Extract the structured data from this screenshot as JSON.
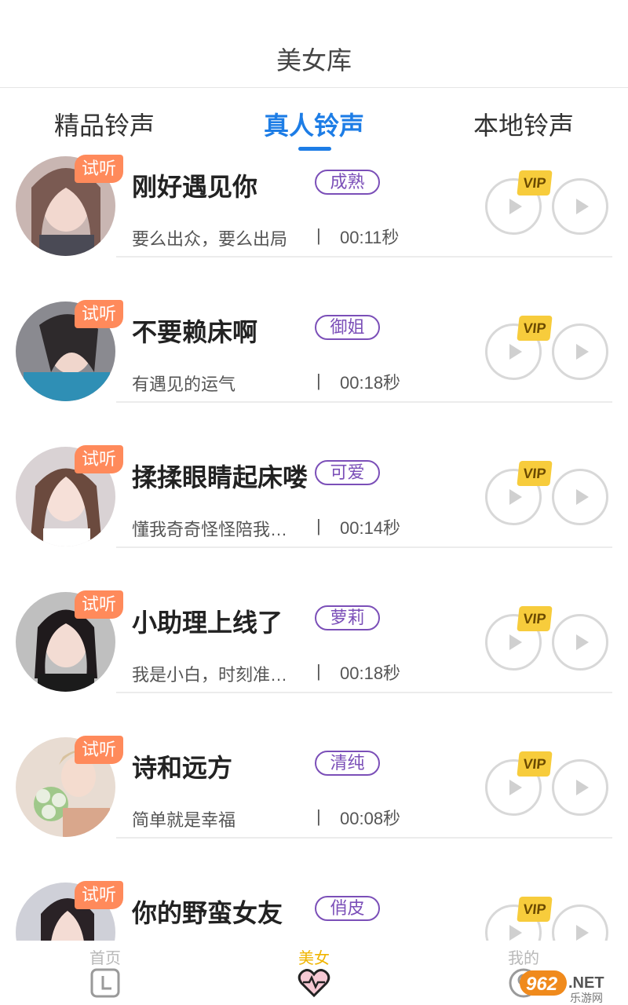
{
  "header": {
    "title": "美女库"
  },
  "tabs": [
    {
      "label": "精品铃声",
      "active": false
    },
    {
      "label": "真人铃声",
      "active": true
    },
    {
      "label": "本地铃声",
      "active": false
    }
  ],
  "trial_label": "试听",
  "vip_label": "VIP",
  "separator": "|",
  "items": [
    {
      "name": "刚好遇见你",
      "tag": "成熟",
      "desc": "要么出众，要么出局",
      "duration": "00:11秒"
    },
    {
      "name": "不要赖床啊",
      "tag": "御姐",
      "desc": "有遇见的运气",
      "duration": "00:18秒"
    },
    {
      "name": "揉揉眼睛起床喽",
      "tag": "可爱",
      "desc": "懂我奇奇怪怪陪我…",
      "duration": "00:14秒"
    },
    {
      "name": "小助理上线了",
      "tag": "萝莉",
      "desc": "我是小白，时刻准…",
      "duration": "00:18秒"
    },
    {
      "name": "诗和远方",
      "tag": "清纯",
      "desc": "简单就是幸福",
      "duration": "00:08秒"
    },
    {
      "name": "你的野蛮女友",
      "tag": "俏皮",
      "desc": "",
      "duration": ""
    }
  ],
  "bottom_nav": [
    {
      "label": "首页",
      "icon": "clock-icon",
      "active": false
    },
    {
      "label": "美女",
      "icon": "heart-pulse-icon",
      "active": true
    },
    {
      "label": "我的",
      "icon": "user-icon",
      "active": false
    }
  ],
  "watermark": "962.NET 乐游网",
  "colors": {
    "accent": "#1d7de6",
    "tag": "#7b4fb8",
    "trial": "#ff8a5b",
    "vip": "#f7cc3c",
    "nav_active": "#f0b400"
  }
}
